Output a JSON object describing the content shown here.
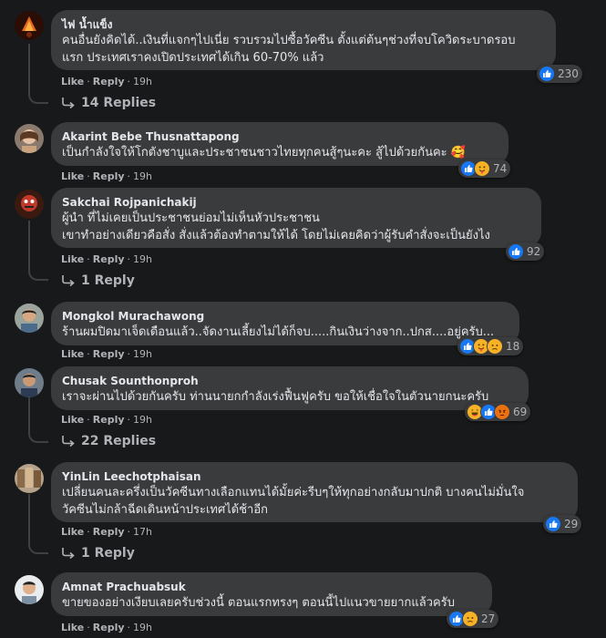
{
  "comments": [
    {
      "name": "ไฟ น้ำแข็ง",
      "lines": [
        "คนอื่นยังคิดได้..เงินที่แจกๆไปเนี่ย รวบรวมไปซื้อวัคซีน ตั้งแต่ต้นๆช่วงที่จบโควิดระบาดรอบ",
        "แรก ประเทศเราคงเปิดประเทศได้เกิน 60-70% แล้ว"
      ],
      "like": "Like",
      "reply": "Reply",
      "time": "19h",
      "reaction_count": "230",
      "replies": "14 Replies"
    },
    {
      "name": "Akarint Bebe Thusnattapong",
      "lines": [
        "เป็นกำลังใจให้โกตังชาบูและประชาชนชาวไทยทุกคนสู้ๆนะคะ สู้ไปด้วยกันคะ 🥰"
      ],
      "like": "Like",
      "reply": "Reply",
      "time": "19h",
      "reaction_count": "74"
    },
    {
      "name": "Sakchai Rojpanichakij",
      "lines": [
        "ผู้นำ ที่ไม่เคยเป็นประชาชนย่อมไม่เห็นหัวประชาชน",
        "เขาทำอย่างเดียวคือสั่ง สั่งแล้วต้องทำตามให้ได้ โดยไม่เคยคิดว่าผู้รับคำสั่งจะเป็นยังไง"
      ],
      "like": "Like",
      "reply": "Reply",
      "time": "19h",
      "reaction_count": "92",
      "replies": "1 Reply"
    },
    {
      "name": "Mongkol Murachawong",
      "lines": [
        "ร้านผมปิดมาเจ็ดเดือนแล้ว..จัดงานเลี้ยงไม่ได้ก็จบ.....กินเงินว่างจาก..ปกส....อยู่ครับ..."
      ],
      "like": "Like",
      "reply": "Reply",
      "time": "19h",
      "reaction_count": "18"
    },
    {
      "name": "Chusak Sounthonproh",
      "lines": [
        "เราจะผ่านไปด้วยกันครับ ท่านนายกกำลังเร่งฟื้นฟูครับ ขอให้เชื่อใจในตัวนายกนะครับ"
      ],
      "like": "Like",
      "reply": "Reply",
      "time": "19h",
      "reaction_count": "69",
      "replies": "22 Replies"
    },
    {
      "name": "YinLin Leechotphaisan",
      "lines": [
        "เปลี่ยนคนละครึ่งเป็นวัคซีนทางเลือกแทนได้มั้ยค่ะรีบๆให้ทุกอย่างกลับมาปกติ บางคนไม่มั่นใจ",
        "วัคซีนไม่กล้าฉีดเดินหน้าประเทศได้ช้าอีก"
      ],
      "like": "Like",
      "reply": "Reply",
      "time": "17h",
      "reaction_count": "29",
      "replies": "1 Reply"
    },
    {
      "name": "Amnat Prachuabsuk",
      "lines": [
        "ขายของอย่างเงียบเลยครับช่วงนี้ ตอนแรกทรงๆ ตอนนี้ไปแนวขายยากแล้วครับ"
      ],
      "like": "Like",
      "reply": "Reply",
      "time": "19h",
      "reaction_count": "27"
    }
  ],
  "colors": {
    "background": "#18191a",
    "bubble": "#3a3b3c",
    "text": "#e4e6eb",
    "secondary": "#b0b3b8",
    "like_blue": "#1877f2",
    "love_red": "#f33e58",
    "emoji_yellow": "#f7b125"
  }
}
